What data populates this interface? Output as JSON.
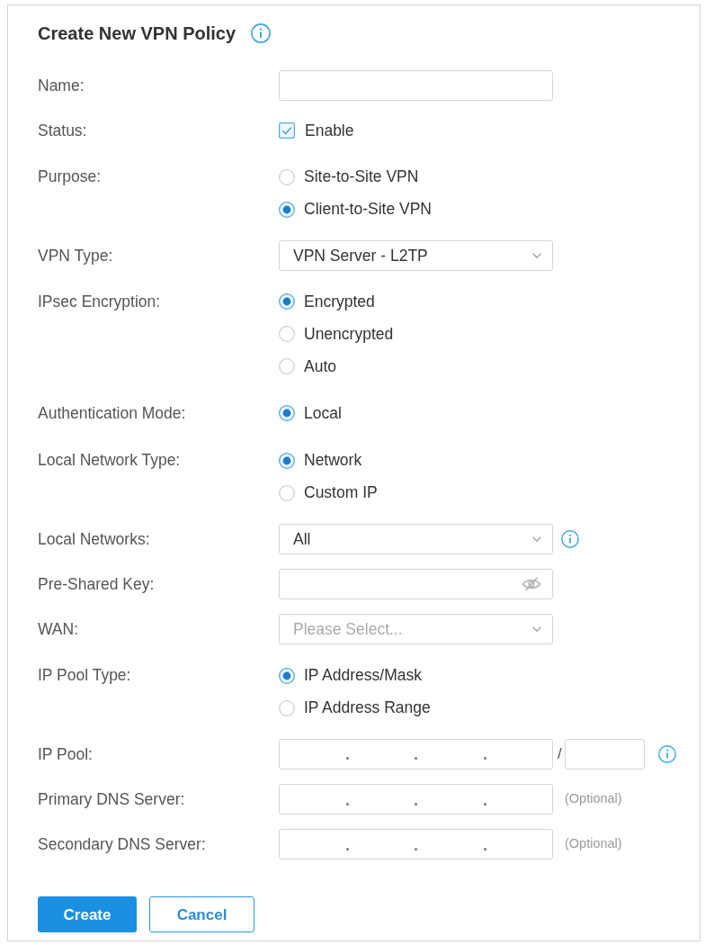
{
  "header": {
    "title": "Create New VPN Policy",
    "info": true
  },
  "fields": [
    {
      "kind": "text",
      "label": "Name:"
    },
    {
      "kind": "checkbox",
      "label": "Status:",
      "option": "Enable",
      "checked": true
    },
    {
      "kind": "radio",
      "label": "Purpose:",
      "options": [
        {
          "label": "Site-to-Site VPN",
          "selected": false
        },
        {
          "label": "Client-to-Site VPN",
          "selected": true
        }
      ]
    },
    {
      "kind": "select",
      "label": "VPN Type:",
      "value": "VPN Server - L2TP"
    },
    {
      "kind": "radio",
      "label": "IPsec Encryption:",
      "options": [
        {
          "label": "Encrypted",
          "selected": true
        },
        {
          "label": "Unencrypted",
          "selected": false
        },
        {
          "label": "Auto",
          "selected": false
        }
      ]
    },
    {
      "kind": "radio",
      "label": "Authentication Mode:",
      "options": [
        {
          "label": "Local",
          "selected": true
        }
      ]
    },
    {
      "kind": "radio",
      "label": "Local Network Type:",
      "options": [
        {
          "label": "Network",
          "selected": true
        },
        {
          "label": "Custom IP",
          "selected": false
        }
      ]
    },
    {
      "kind": "select",
      "label": "Local Networks:",
      "value": "All",
      "info": true
    },
    {
      "kind": "password",
      "label": "Pre-Shared Key:"
    },
    {
      "kind": "select",
      "label": "WAN:",
      "placeholder": "Please Select..."
    },
    {
      "kind": "radio",
      "label": "IP Pool Type:",
      "options": [
        {
          "label": "IP Address/Mask",
          "selected": true
        },
        {
          "label": "IP Address Range",
          "selected": false
        }
      ]
    },
    {
      "kind": "ip",
      "label": "IP Pool:",
      "separator": "/",
      "info": true
    },
    {
      "kind": "ip",
      "label": "Primary DNS Server:",
      "note": "(Optional)"
    },
    {
      "kind": "ip",
      "label": "Secondary DNS Server:",
      "note": "(Optional)"
    }
  ],
  "buttons": [
    {
      "label": "Create",
      "kind": "primary"
    },
    {
      "label": "Cancel",
      "kind": "secondary"
    }
  ]
}
